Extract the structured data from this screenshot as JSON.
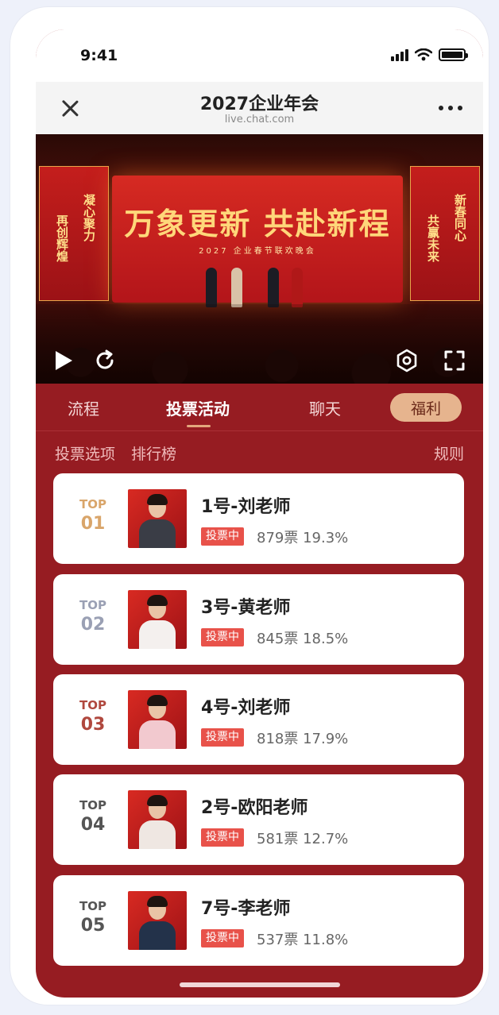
{
  "status_bar": {
    "time": "9:41"
  },
  "nav": {
    "title": "2027企业年会",
    "subtitle": "live.chat.com"
  },
  "video": {
    "slogan": "万象更新 共赴新程",
    "stage_subtitle": "2027 企业春节联欢晚会",
    "left_banner_lines": [
      "凝心聚力",
      "再创辉煌"
    ],
    "right_banner_lines": [
      "新春同心",
      "共赢未来"
    ]
  },
  "tabs": [
    {
      "label": "流程"
    },
    {
      "label": "投票活动"
    },
    {
      "label": "聊天"
    },
    {
      "label": "福利"
    }
  ],
  "subnav": {
    "vote_options": "投票选项",
    "leaderboard": "排行榜",
    "rules": "规则"
  },
  "colors": {
    "gold": "#d9a56a",
    "silver": "#9aa0b4",
    "bronze": "#b0483e",
    "plain": "#555555",
    "accent": "#961c22"
  },
  "rankings": [
    {
      "top": "TOP",
      "rank": "01",
      "name": "1号-刘老师",
      "status": "投票中",
      "votes": "879票",
      "percent": "19.3%"
    },
    {
      "top": "TOP",
      "rank": "02",
      "name": "3号-黄老师",
      "status": "投票中",
      "votes": "845票",
      "percent": "18.5%"
    },
    {
      "top": "TOP",
      "rank": "03",
      "name": "4号-刘老师",
      "status": "投票中",
      "votes": "818票",
      "percent": "17.9%"
    },
    {
      "top": "TOP",
      "rank": "04",
      "name": "2号-欧阳老师",
      "status": "投票中",
      "votes": "581票",
      "percent": "12.7%"
    },
    {
      "top": "TOP",
      "rank": "05",
      "name": "7号-李老师",
      "status": "投票中",
      "votes": "537票",
      "percent": "11.8%"
    }
  ]
}
